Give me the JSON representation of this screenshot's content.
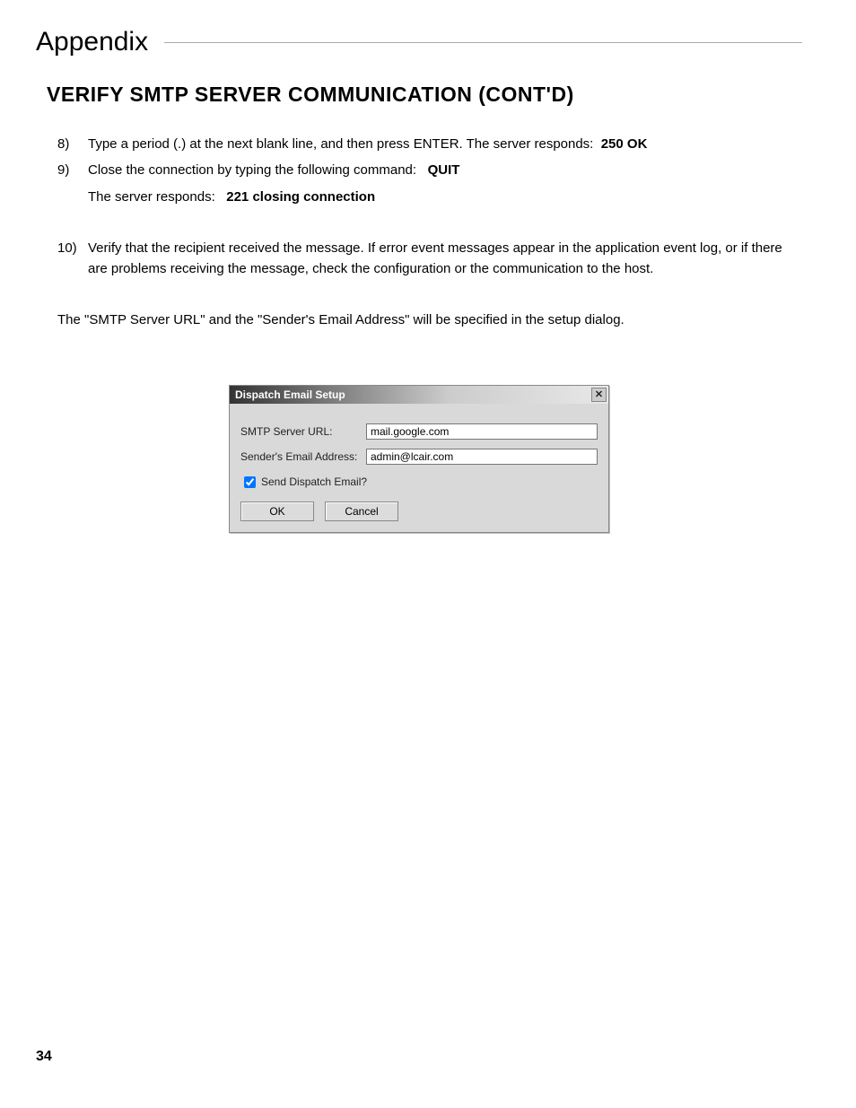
{
  "header": {
    "appendix": "Appendix",
    "section": "VERIFY SMTP SERVER COMMUNICATION (CONT'D)"
  },
  "steps": {
    "s8_num": "8)",
    "s8_text_a": "Type a period (.) at the next blank line, and then press ENTER. The server responds:",
    "s8_code": "250 OK",
    "s9_num": "9)",
    "s9_text_a": "Close the connection by typing the following command:",
    "s9_code": "QUIT",
    "s9_sub_a": "The server responds:",
    "s9_sub_code": "221 closing connection",
    "s10_num": "10)",
    "s10_text": "Verify that the recipient received the message. If error event messages appear in the application event log, or if there are problems receiving the message, check the configuration or the communication to the host."
  },
  "note": "The \"SMTP Server URL\" and the \"Sender's Email Address\" will be specified in the setup dialog.",
  "dialog": {
    "title": "Dispatch Email Setup",
    "close_glyph": "✕",
    "url_label": "SMTP Server URL:",
    "url_value": "mail.google.com",
    "email_label": "Sender's Email Address:",
    "email_value": "admin@lcair.com",
    "check_label": "Send Dispatch Email?",
    "ok": "OK",
    "cancel": "Cancel"
  },
  "page_number": "34"
}
